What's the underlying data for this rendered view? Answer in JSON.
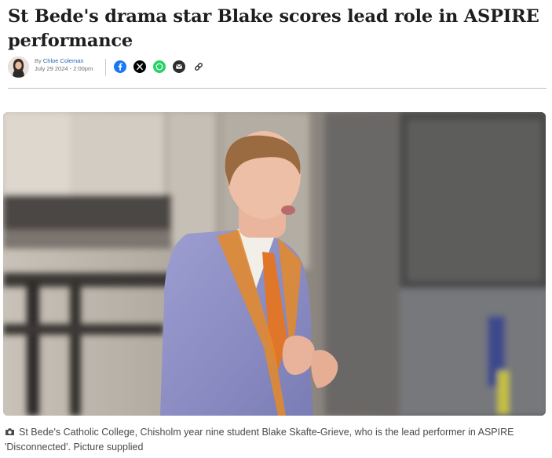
{
  "article": {
    "headline": "St Bede's drama star Blake scores lead role in ASPIRE performance",
    "byline": {
      "prefix": "By",
      "author": "Chloe Coleman",
      "date": "July 29 2024 - 2:00pm"
    },
    "share_icons": [
      "facebook-icon",
      "x-icon",
      "whatsapp-icon",
      "email-icon",
      "link-icon"
    ],
    "image": {
      "description_icon": "camera-icon",
      "caption": "St Bede's Catholic College, Chisholm year nine student Blake Skafte-Grieve, who is the lead performer in ASPIRE 'Disconnected'. Picture supplied"
    }
  },
  "colors": {
    "facebook": "#1877f2",
    "x": "#000000",
    "whatsapp": "#25d366",
    "email": "#2d2d2d",
    "author_link": "#2966b8"
  }
}
